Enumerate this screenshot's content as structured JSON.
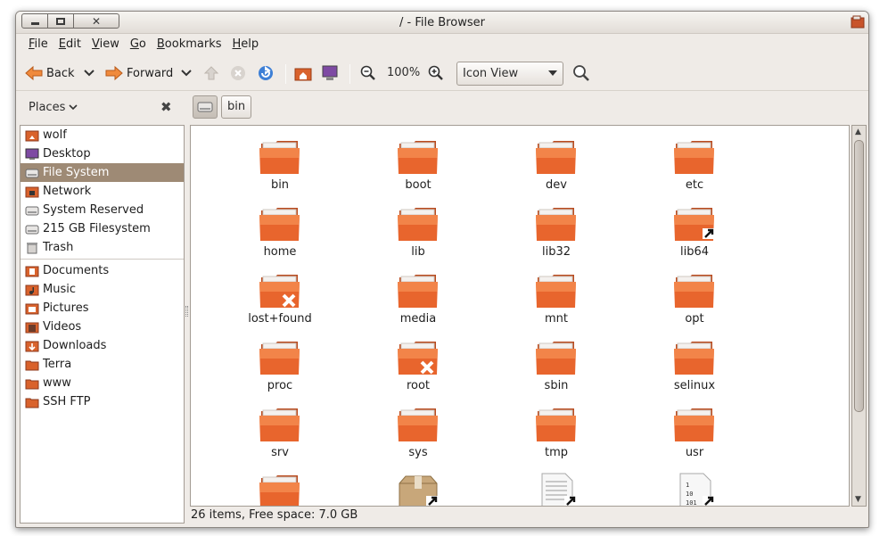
{
  "window": {
    "title": "/ - File Browser"
  },
  "menu": [
    {
      "name": "menu-file",
      "first": "F",
      "rest": "ile"
    },
    {
      "name": "menu-edit",
      "first": "E",
      "rest": "dit"
    },
    {
      "name": "menu-view",
      "first": "V",
      "rest": "iew"
    },
    {
      "name": "menu-go",
      "first": "G",
      "rest": "o"
    },
    {
      "name": "menu-bookmarks",
      "first": "B",
      "rest": "ookmarks"
    },
    {
      "name": "menu-help",
      "first": "H",
      "rest": "elp"
    }
  ],
  "toolbar": {
    "back_label": "Back",
    "forward_label": "Forward",
    "zoom_level": "100%",
    "view_mode": "Icon View"
  },
  "location": {
    "places_label": "Places",
    "path_segment": "bin"
  },
  "sidebar": {
    "devices": [
      {
        "label": "wolf",
        "icon": "home-icon",
        "selected": false
      },
      {
        "label": "Desktop",
        "icon": "desktop-icon",
        "selected": false
      },
      {
        "label": "File System",
        "icon": "drive-icon",
        "selected": true
      },
      {
        "label": "Network",
        "icon": "network-icon",
        "selected": false
      },
      {
        "label": "System Reserved",
        "icon": "drive-icon",
        "selected": false
      },
      {
        "label": "215 GB Filesystem",
        "icon": "drive-icon",
        "selected": false
      },
      {
        "label": "Trash",
        "icon": "trash-icon",
        "selected": false
      }
    ],
    "bookmarks": [
      {
        "label": "Documents",
        "icon": "documents-folder-icon"
      },
      {
        "label": "Music",
        "icon": "music-folder-icon"
      },
      {
        "label": "Pictures",
        "icon": "pictures-folder-icon"
      },
      {
        "label": "Videos",
        "icon": "videos-folder-icon"
      },
      {
        "label": "Downloads",
        "icon": "downloads-folder-icon"
      },
      {
        "label": "Terra",
        "icon": "folder-icon"
      },
      {
        "label": "www",
        "icon": "folder-icon"
      },
      {
        "label": "SSH FTP",
        "icon": "folder-icon"
      }
    ]
  },
  "files": [
    {
      "name": "bin",
      "type": "folder",
      "emblem": ""
    },
    {
      "name": "boot",
      "type": "folder",
      "emblem": ""
    },
    {
      "name": "dev",
      "type": "folder",
      "emblem": ""
    },
    {
      "name": "etc",
      "type": "folder",
      "emblem": ""
    },
    {
      "name": "home",
      "type": "folder",
      "emblem": ""
    },
    {
      "name": "lib",
      "type": "folder",
      "emblem": ""
    },
    {
      "name": "lib32",
      "type": "folder",
      "emblem": ""
    },
    {
      "name": "lib64",
      "type": "folder",
      "emblem": "symlink"
    },
    {
      "name": "lost+found",
      "type": "folder",
      "emblem": "no-access"
    },
    {
      "name": "media",
      "type": "folder",
      "emblem": ""
    },
    {
      "name": "mnt",
      "type": "folder",
      "emblem": ""
    },
    {
      "name": "opt",
      "type": "folder",
      "emblem": ""
    },
    {
      "name": "proc",
      "type": "folder",
      "emblem": ""
    },
    {
      "name": "root",
      "type": "folder",
      "emblem": "no-access"
    },
    {
      "name": "sbin",
      "type": "folder",
      "emblem": ""
    },
    {
      "name": "selinux",
      "type": "folder",
      "emblem": ""
    },
    {
      "name": "srv",
      "type": "folder",
      "emblem": ""
    },
    {
      "name": "sys",
      "type": "folder",
      "emblem": ""
    },
    {
      "name": "tmp",
      "type": "folder",
      "emblem": ""
    },
    {
      "name": "usr",
      "type": "folder",
      "emblem": ""
    },
    {
      "name": "",
      "type": "folder",
      "emblem": ""
    },
    {
      "name": "",
      "type": "package",
      "emblem": "symlink"
    },
    {
      "name": "",
      "type": "text",
      "emblem": "symlink"
    },
    {
      "name": "",
      "type": "binary",
      "emblem": "symlink"
    }
  ],
  "status": {
    "text": "26 items, Free space: 7.0 GB"
  },
  "colors": {
    "folder": "#e8652d",
    "selection": "#9e8a75",
    "window_bg": "#efebe7"
  }
}
